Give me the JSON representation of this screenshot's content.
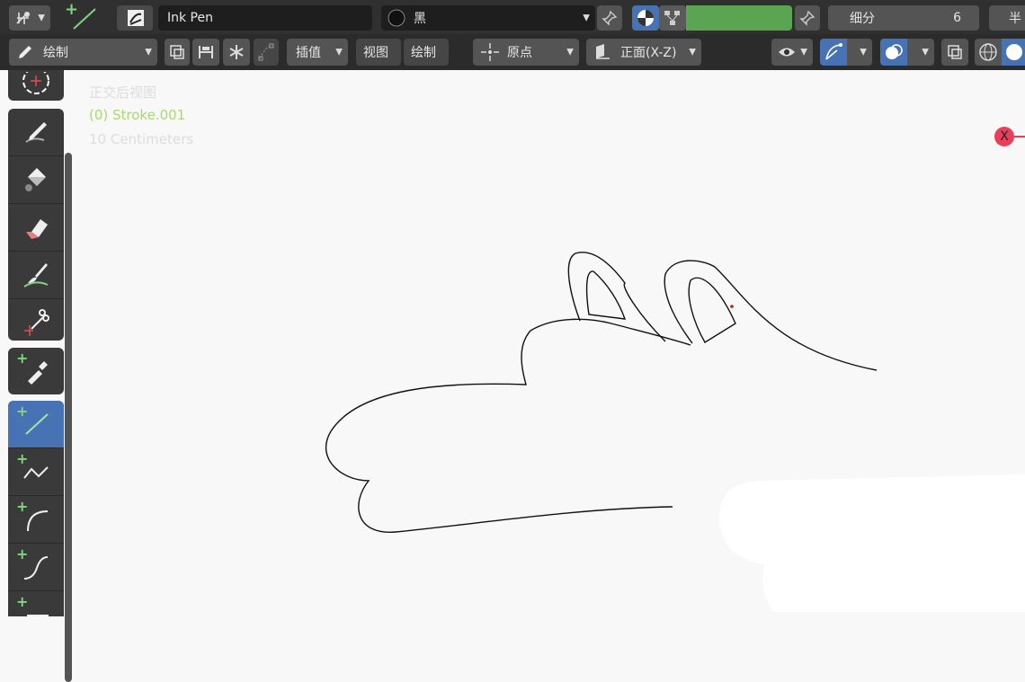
{
  "header": {
    "brush_name": "Ink Pen",
    "material_name": "黑",
    "subdivision_label": "细分",
    "subdivision_value": "6",
    "cut_label": "半"
  },
  "toolbar2": {
    "mode": "绘制",
    "interpolate": "插值",
    "view_menu": "视图",
    "draw_menu": "绘制",
    "pivot": "原点",
    "orientation": "正面(X-Z)"
  },
  "viewport": {
    "view_name": "正交后视图",
    "object_name": "(0) Stroke.001",
    "scale": "10 Centimeters",
    "axis_x": "X"
  },
  "colors": {
    "accent_blue": "#4772b3",
    "header_bg": "#303030",
    "green_bar": "#5aa452",
    "object_label": "#a8d96b"
  },
  "tools": [
    "annotate-icon",
    "draw-icon",
    "fill-icon",
    "erase-icon",
    "tint-icon",
    "cutter-icon",
    "eyedropper-icon",
    "line-icon",
    "polyline-icon",
    "arc-icon",
    "curve-icon",
    "box-icon"
  ]
}
